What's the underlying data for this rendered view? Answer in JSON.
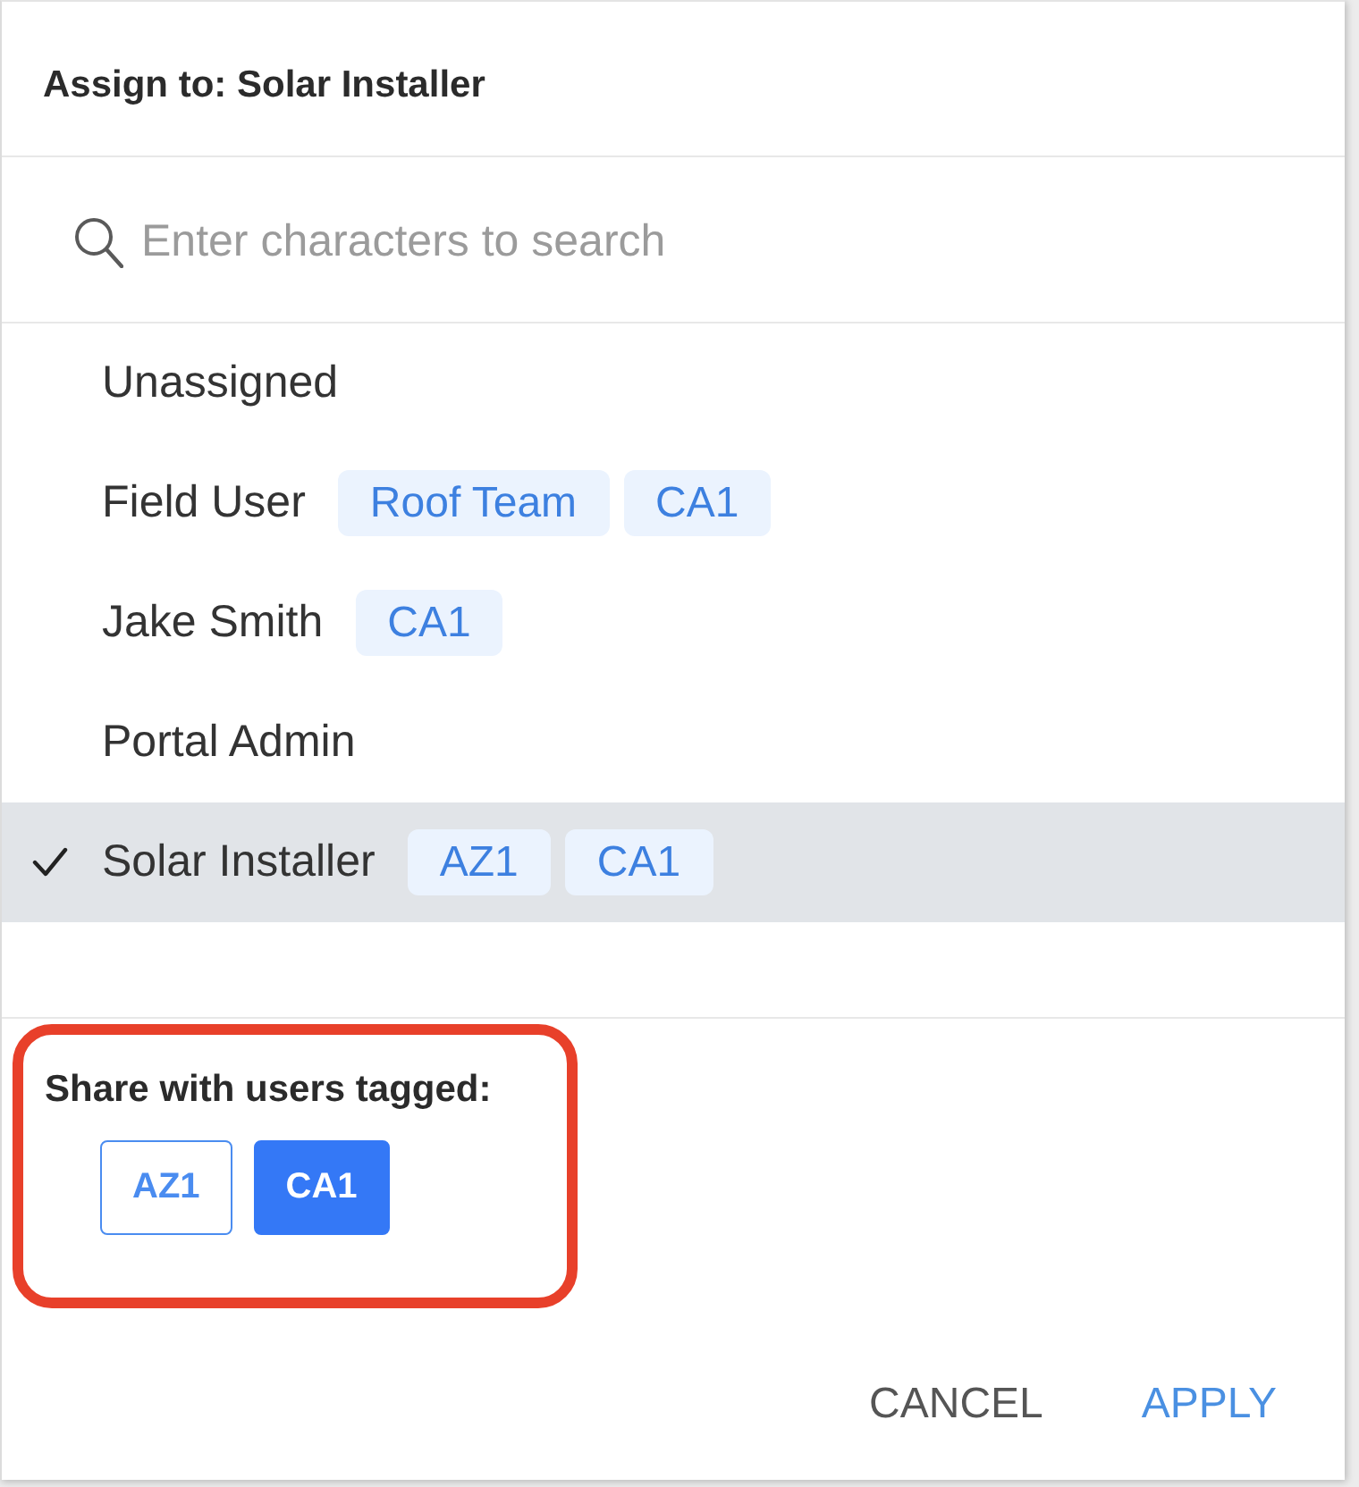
{
  "dialog": {
    "title": "Assign to: Solar Installer"
  },
  "search": {
    "placeholder": "Enter characters to search"
  },
  "users": [
    {
      "name": "Unassigned",
      "selected": false
    },
    {
      "name": "Field User",
      "selected": false,
      "tags": [
        "Roof Team",
        "CA1"
      ]
    },
    {
      "name": "Jake Smith",
      "selected": false,
      "tags": [
        "CA1"
      ]
    },
    {
      "name": "Portal Admin",
      "selected": false
    },
    {
      "name": "Solar Installer",
      "selected": true,
      "tags": [
        "AZ1",
        "CA1"
      ]
    }
  ],
  "share": {
    "label": "Share with users tagged:",
    "highlighted": true,
    "tags": [
      {
        "label": "AZ1",
        "selected": false
      },
      {
        "label": "CA1",
        "selected": true
      }
    ]
  },
  "buttons": [
    {
      "label": "CANCEL",
      "kind": "secondary"
    },
    {
      "label": "APPLY",
      "kind": "primary"
    }
  ]
}
